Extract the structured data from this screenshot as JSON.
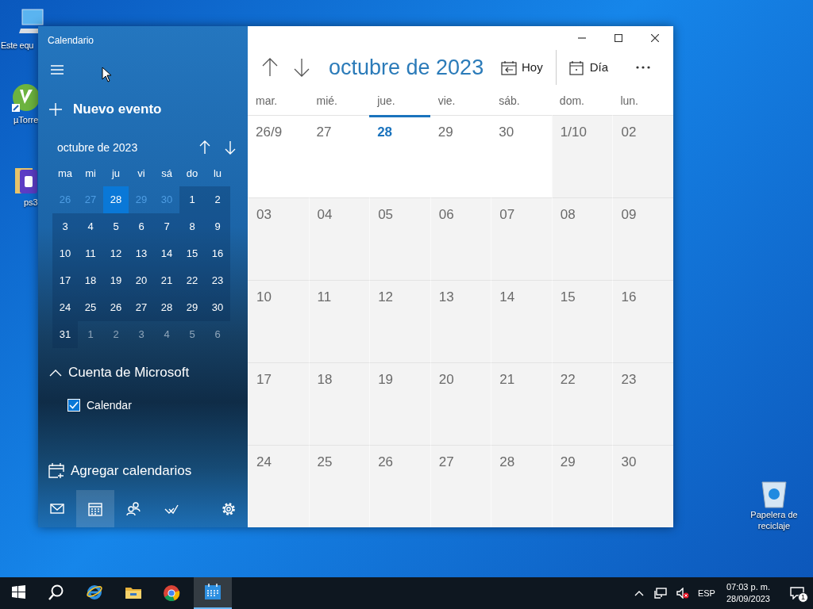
{
  "desktop_icons": [
    {
      "kind": "computer",
      "label": "Este equ"
    },
    {
      "kind": "torrent",
      "label": "µTorre"
    },
    {
      "kind": "file",
      "label": "ps3"
    },
    {
      "kind": "recycle",
      "label": "Papelera de reciclaje"
    }
  ],
  "window": {
    "title": "Calendario",
    "controls": [
      {
        "kind": "minimize"
      },
      {
        "kind": "maximize"
      },
      {
        "kind": "close"
      }
    ]
  },
  "sidebar": {
    "new_event": "Nuevo evento",
    "mini_calendar": {
      "title": "octubre de 2023",
      "weekdays": [
        "ma",
        "mi",
        "ju",
        "vi",
        "sá",
        "do",
        "lu"
      ],
      "weeks": [
        [
          {
            "day": "26",
            "kind": "previous",
            "today": false
          },
          {
            "day": "27",
            "kind": "previous",
            "today": false
          },
          {
            "day": "28",
            "kind": "previous",
            "today": true
          },
          {
            "day": "29",
            "kind": "previous",
            "today": false
          },
          {
            "day": "30",
            "kind": "previous",
            "today": false
          },
          {
            "day": "1",
            "kind": "current",
            "today": false
          },
          {
            "day": "2",
            "kind": "current",
            "today": false
          }
        ],
        [
          {
            "day": "3",
            "kind": "current",
            "today": false
          },
          {
            "day": "4",
            "kind": "current",
            "today": false
          },
          {
            "day": "5",
            "kind": "current",
            "today": false
          },
          {
            "day": "6",
            "kind": "current",
            "today": false
          },
          {
            "day": "7",
            "kind": "current",
            "today": false
          },
          {
            "day": "8",
            "kind": "current",
            "today": false
          },
          {
            "day": "9",
            "kind": "current",
            "today": false
          }
        ],
        [
          {
            "day": "10",
            "kind": "current",
            "today": false
          },
          {
            "day": "11",
            "kind": "current",
            "today": false
          },
          {
            "day": "12",
            "kind": "current",
            "today": false
          },
          {
            "day": "13",
            "kind": "current",
            "today": false
          },
          {
            "day": "14",
            "kind": "current",
            "today": false
          },
          {
            "day": "15",
            "kind": "current",
            "today": false
          },
          {
            "day": "16",
            "kind": "current",
            "today": false
          }
        ],
        [
          {
            "day": "17",
            "kind": "current",
            "today": false
          },
          {
            "day": "18",
            "kind": "current",
            "today": false
          },
          {
            "day": "19",
            "kind": "current",
            "today": false
          },
          {
            "day": "20",
            "kind": "current",
            "today": false
          },
          {
            "day": "21",
            "kind": "current",
            "today": false
          },
          {
            "day": "22",
            "kind": "current",
            "today": false
          },
          {
            "day": "23",
            "kind": "current",
            "today": false
          }
        ],
        [
          {
            "day": "24",
            "kind": "current",
            "today": false
          },
          {
            "day": "25",
            "kind": "current",
            "today": false
          },
          {
            "day": "26",
            "kind": "current",
            "today": false
          },
          {
            "day": "27",
            "kind": "current",
            "today": false
          },
          {
            "day": "28",
            "kind": "current",
            "today": false
          },
          {
            "day": "29",
            "kind": "current",
            "today": false
          },
          {
            "day": "30",
            "kind": "current",
            "today": false
          }
        ],
        [
          {
            "day": "31",
            "kind": "current",
            "today": false
          },
          {
            "day": "1",
            "kind": "next",
            "today": false
          },
          {
            "day": "2",
            "kind": "next",
            "today": false
          },
          {
            "day": "3",
            "kind": "next",
            "today": false
          },
          {
            "day": "4",
            "kind": "next",
            "today": false
          },
          {
            "day": "5",
            "kind": "next",
            "today": false
          },
          {
            "day": "6",
            "kind": "next",
            "today": false
          }
        ]
      ]
    },
    "accounts": [
      {
        "name": "Cuenta de Microsoft",
        "expanded": true,
        "calendars": [
          {
            "label": "Calendar",
            "checked": true
          }
        ]
      }
    ],
    "add_calendars": "Agregar calendarios",
    "nav": [
      {
        "kind": "mail",
        "selected": false
      },
      {
        "kind": "calendar",
        "selected": true
      },
      {
        "kind": "people",
        "selected": false
      },
      {
        "kind": "todo",
        "selected": false
      },
      {
        "kind": "settings",
        "selected": false
      }
    ]
  },
  "main": {
    "title": "octubre de 2023",
    "buttons": [
      {
        "kind": "today",
        "label": "Hoy"
      },
      {
        "kind": "day",
        "label": "Día"
      },
      {
        "kind": "more"
      }
    ],
    "weekdays": [
      "mar.",
      "mié.",
      "jue.",
      "vie.",
      "sáb.",
      "dom.",
      "lun."
    ],
    "weeks": [
      [
        {
          "label": "26/9",
          "kind": "previous",
          "today": false
        },
        {
          "label": "27",
          "kind": "previous",
          "today": false
        },
        {
          "label": "28",
          "kind": "previous",
          "today": true
        },
        {
          "label": "29",
          "kind": "previous",
          "today": false
        },
        {
          "label": "30",
          "kind": "previous",
          "today": false
        },
        {
          "label": "1/10",
          "kind": "current",
          "today": false
        },
        {
          "label": "02",
          "kind": "current",
          "today": false
        }
      ],
      [
        {
          "label": "03",
          "kind": "current",
          "today": false
        },
        {
          "label": "04",
          "kind": "current",
          "today": false
        },
        {
          "label": "05",
          "kind": "current",
          "today": false
        },
        {
          "label": "06",
          "kind": "current",
          "today": false
        },
        {
          "label": "07",
          "kind": "current",
          "today": false
        },
        {
          "label": "08",
          "kind": "current",
          "today": false
        },
        {
          "label": "09",
          "kind": "current",
          "today": false
        }
      ],
      [
        {
          "label": "10",
          "kind": "current",
          "today": false
        },
        {
          "label": "11",
          "kind": "current",
          "today": false
        },
        {
          "label": "12",
          "kind": "current",
          "today": false
        },
        {
          "label": "13",
          "kind": "current",
          "today": false
        },
        {
          "label": "14",
          "kind": "current",
          "today": false
        },
        {
          "label": "15",
          "kind": "current",
          "today": false
        },
        {
          "label": "16",
          "kind": "current",
          "today": false
        }
      ],
      [
        {
          "label": "17",
          "kind": "current",
          "today": false
        },
        {
          "label": "18",
          "kind": "current",
          "today": false
        },
        {
          "label": "19",
          "kind": "current",
          "today": false
        },
        {
          "label": "20",
          "kind": "current",
          "today": false
        },
        {
          "label": "21",
          "kind": "current",
          "today": false
        },
        {
          "label": "22",
          "kind": "current",
          "today": false
        },
        {
          "label": "23",
          "kind": "current",
          "today": false
        }
      ],
      [
        {
          "label": "24",
          "kind": "current",
          "today": false
        },
        {
          "label": "25",
          "kind": "current",
          "today": false
        },
        {
          "label": "26",
          "kind": "current",
          "today": false
        },
        {
          "label": "27",
          "kind": "current",
          "today": false
        },
        {
          "label": "28",
          "kind": "current",
          "today": false
        },
        {
          "label": "29",
          "kind": "current",
          "today": false
        },
        {
          "label": "30",
          "kind": "current",
          "today": false
        }
      ]
    ]
  },
  "taskbar": {
    "apps": [
      {
        "kind": "start",
        "selected": false
      },
      {
        "kind": "search",
        "selected": false
      },
      {
        "kind": "ie",
        "selected": false
      },
      {
        "kind": "folder",
        "selected": false
      },
      {
        "kind": "chrome",
        "selected": false
      },
      {
        "kind": "calendar",
        "selected": true
      }
    ],
    "tray": {
      "language": "ESP",
      "time": "07:03 p. m.",
      "date": "28/09/2023",
      "notifications": "1"
    }
  }
}
